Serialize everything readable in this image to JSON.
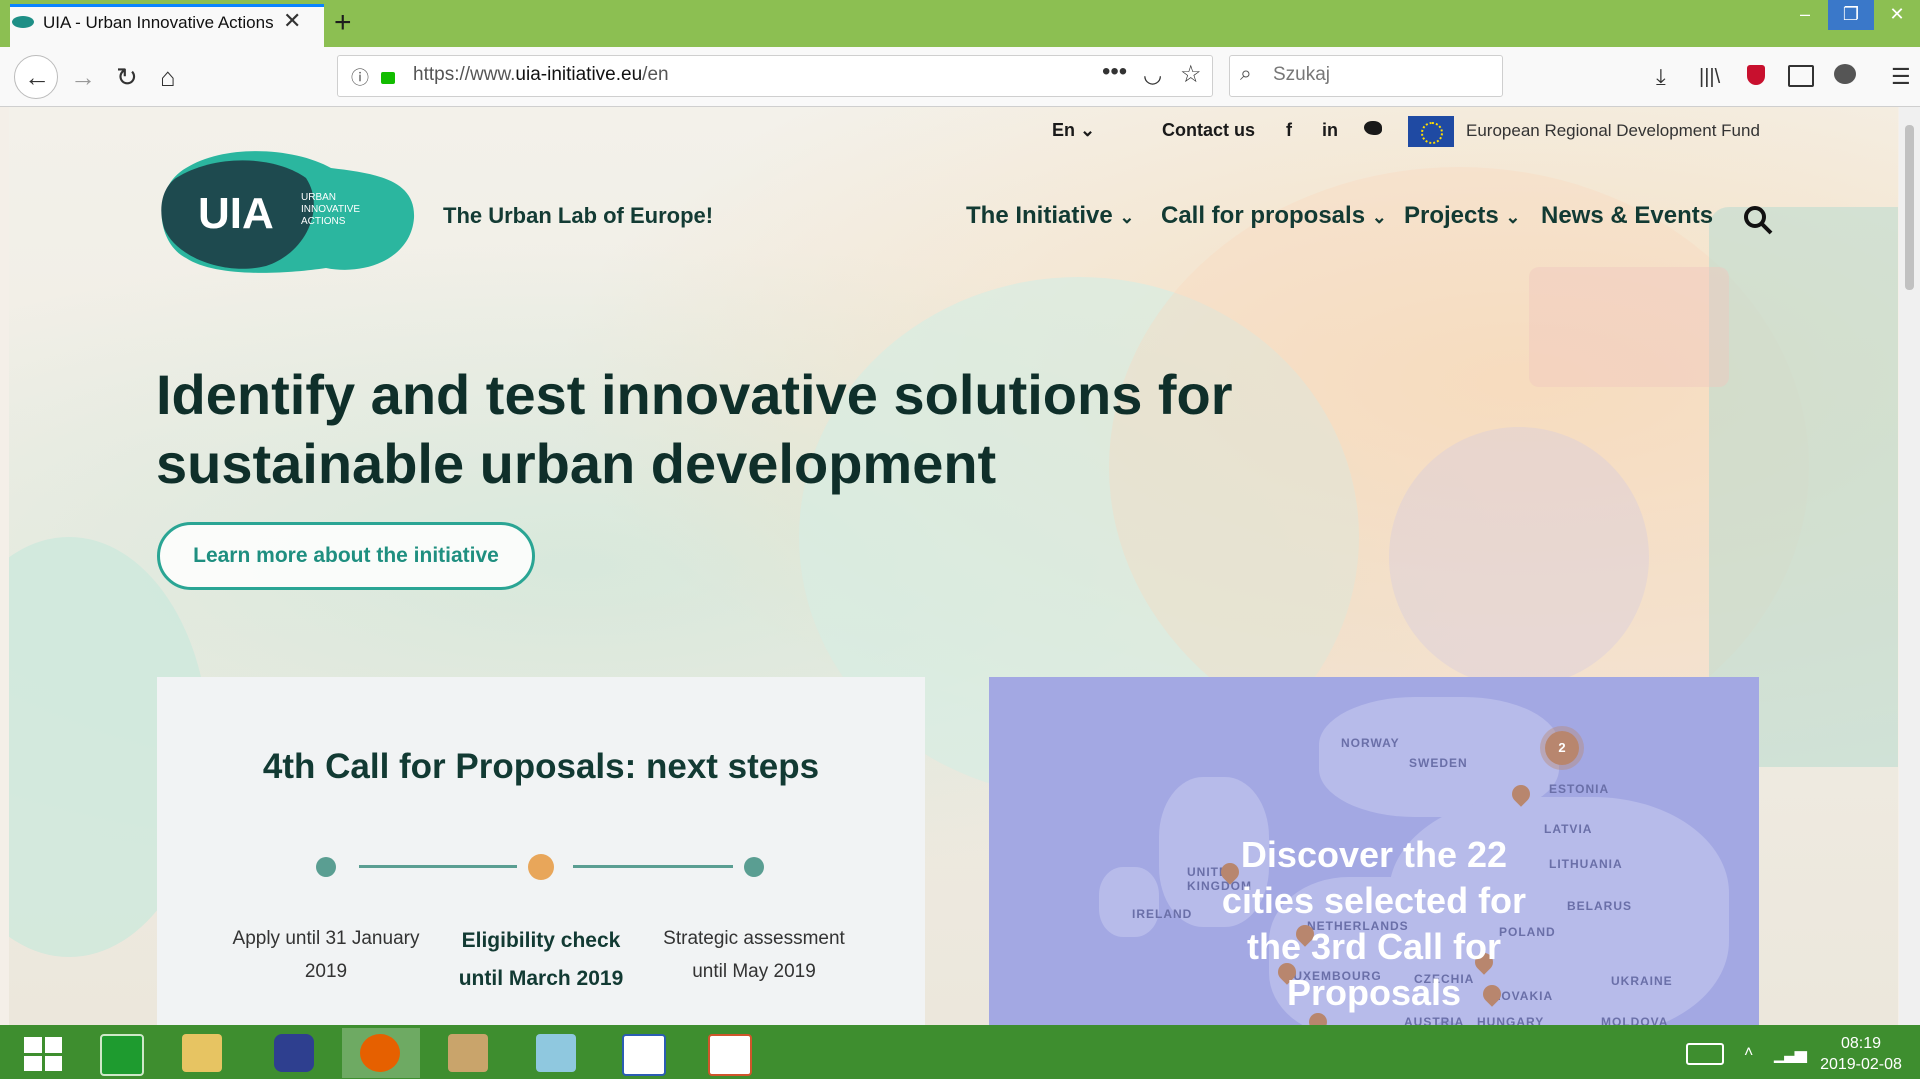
{
  "browser": {
    "tab_title": "UIA - Urban Innovative Actions",
    "url_prefix": "https://www.",
    "url_domain": "uia-initiative.eu",
    "url_path": "/en",
    "search_placeholder": "Szukaj"
  },
  "utility_nav": {
    "language": "En",
    "contact": "Contact us",
    "social": [
      "f",
      "in"
    ],
    "fund": "European Regional Development Fund"
  },
  "logo": {
    "text": "UIA",
    "subtext": [
      "URBAN",
      "INNOVATIVE",
      "ACTIONS"
    ],
    "tagline": "The Urban Lab of Europe!"
  },
  "main_nav": [
    "The Initiative",
    "Call for proposals",
    "Projects",
    "News & Events"
  ],
  "hero": {
    "headline_line1": "Identify and test innovative solutions for",
    "headline_line2": "sustainable urban development",
    "cta": "Learn more about the initiative"
  },
  "call_card": {
    "title": "4th Call for Proposals: next steps",
    "steps": [
      {
        "line1": "Apply until 31 January",
        "line2": "2019"
      },
      {
        "line1": "Eligibility check",
        "line2": "until March 2019"
      },
      {
        "line1": "Strategic assessment",
        "line2": "until May 2019"
      }
    ]
  },
  "map_card": {
    "cta_lines": [
      "Discover the 22",
      "cities selected for",
      "the 3rd Call for",
      "Proposals"
    ],
    "labels": [
      "NORWAY",
      "SWEDEN",
      "ESTONIA",
      "LATVIA",
      "LITHUANIA",
      "BELARUS",
      "IRELAND",
      "UNITED KINGDOM",
      "POLAND",
      "UKRAINE",
      "CZECHIA",
      "SLOVAKIA",
      "HUNGARY",
      "MOLDOVA",
      "NETHERLANDS",
      "LUXEMBOURG",
      "AUSTRIA"
    ],
    "cluster_count": "2"
  },
  "taskbar": {
    "time": "08:19",
    "date": "2019-02-08"
  },
  "colors": {
    "accent": "#2aa594",
    "dark_green": "#123a33",
    "browser_frame": "#8cbf52",
    "taskbar": "#3e8e2f",
    "map_bg": "#a3a8e3"
  }
}
